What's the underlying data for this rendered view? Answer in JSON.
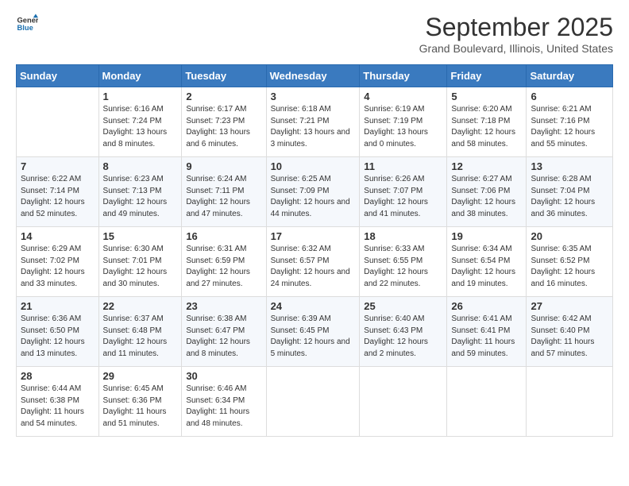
{
  "logo": {
    "line1": "General",
    "line2": "Blue"
  },
  "title": "September 2025",
  "location": "Grand Boulevard, Illinois, United States",
  "days_of_week": [
    "Sunday",
    "Monday",
    "Tuesday",
    "Wednesday",
    "Thursday",
    "Friday",
    "Saturday"
  ],
  "weeks": [
    [
      {
        "day": "",
        "sunrise": "",
        "sunset": "",
        "daylight": ""
      },
      {
        "day": "1",
        "sunrise": "Sunrise: 6:16 AM",
        "sunset": "Sunset: 7:24 PM",
        "daylight": "Daylight: 13 hours and 8 minutes."
      },
      {
        "day": "2",
        "sunrise": "Sunrise: 6:17 AM",
        "sunset": "Sunset: 7:23 PM",
        "daylight": "Daylight: 13 hours and 6 minutes."
      },
      {
        "day": "3",
        "sunrise": "Sunrise: 6:18 AM",
        "sunset": "Sunset: 7:21 PM",
        "daylight": "Daylight: 13 hours and 3 minutes."
      },
      {
        "day": "4",
        "sunrise": "Sunrise: 6:19 AM",
        "sunset": "Sunset: 7:19 PM",
        "daylight": "Daylight: 13 hours and 0 minutes."
      },
      {
        "day": "5",
        "sunrise": "Sunrise: 6:20 AM",
        "sunset": "Sunset: 7:18 PM",
        "daylight": "Daylight: 12 hours and 58 minutes."
      },
      {
        "day": "6",
        "sunrise": "Sunrise: 6:21 AM",
        "sunset": "Sunset: 7:16 PM",
        "daylight": "Daylight: 12 hours and 55 minutes."
      }
    ],
    [
      {
        "day": "7",
        "sunrise": "Sunrise: 6:22 AM",
        "sunset": "Sunset: 7:14 PM",
        "daylight": "Daylight: 12 hours and 52 minutes."
      },
      {
        "day": "8",
        "sunrise": "Sunrise: 6:23 AM",
        "sunset": "Sunset: 7:13 PM",
        "daylight": "Daylight: 12 hours and 49 minutes."
      },
      {
        "day": "9",
        "sunrise": "Sunrise: 6:24 AM",
        "sunset": "Sunset: 7:11 PM",
        "daylight": "Daylight: 12 hours and 47 minutes."
      },
      {
        "day": "10",
        "sunrise": "Sunrise: 6:25 AM",
        "sunset": "Sunset: 7:09 PM",
        "daylight": "Daylight: 12 hours and 44 minutes."
      },
      {
        "day": "11",
        "sunrise": "Sunrise: 6:26 AM",
        "sunset": "Sunset: 7:07 PM",
        "daylight": "Daylight: 12 hours and 41 minutes."
      },
      {
        "day": "12",
        "sunrise": "Sunrise: 6:27 AM",
        "sunset": "Sunset: 7:06 PM",
        "daylight": "Daylight: 12 hours and 38 minutes."
      },
      {
        "day": "13",
        "sunrise": "Sunrise: 6:28 AM",
        "sunset": "Sunset: 7:04 PM",
        "daylight": "Daylight: 12 hours and 36 minutes."
      }
    ],
    [
      {
        "day": "14",
        "sunrise": "Sunrise: 6:29 AM",
        "sunset": "Sunset: 7:02 PM",
        "daylight": "Daylight: 12 hours and 33 minutes."
      },
      {
        "day": "15",
        "sunrise": "Sunrise: 6:30 AM",
        "sunset": "Sunset: 7:01 PM",
        "daylight": "Daylight: 12 hours and 30 minutes."
      },
      {
        "day": "16",
        "sunrise": "Sunrise: 6:31 AM",
        "sunset": "Sunset: 6:59 PM",
        "daylight": "Daylight: 12 hours and 27 minutes."
      },
      {
        "day": "17",
        "sunrise": "Sunrise: 6:32 AM",
        "sunset": "Sunset: 6:57 PM",
        "daylight": "Daylight: 12 hours and 24 minutes."
      },
      {
        "day": "18",
        "sunrise": "Sunrise: 6:33 AM",
        "sunset": "Sunset: 6:55 PM",
        "daylight": "Daylight: 12 hours and 22 minutes."
      },
      {
        "day": "19",
        "sunrise": "Sunrise: 6:34 AM",
        "sunset": "Sunset: 6:54 PM",
        "daylight": "Daylight: 12 hours and 19 minutes."
      },
      {
        "day": "20",
        "sunrise": "Sunrise: 6:35 AM",
        "sunset": "Sunset: 6:52 PM",
        "daylight": "Daylight: 12 hours and 16 minutes."
      }
    ],
    [
      {
        "day": "21",
        "sunrise": "Sunrise: 6:36 AM",
        "sunset": "Sunset: 6:50 PM",
        "daylight": "Daylight: 12 hours and 13 minutes."
      },
      {
        "day": "22",
        "sunrise": "Sunrise: 6:37 AM",
        "sunset": "Sunset: 6:48 PM",
        "daylight": "Daylight: 12 hours and 11 minutes."
      },
      {
        "day": "23",
        "sunrise": "Sunrise: 6:38 AM",
        "sunset": "Sunset: 6:47 PM",
        "daylight": "Daylight: 12 hours and 8 minutes."
      },
      {
        "day": "24",
        "sunrise": "Sunrise: 6:39 AM",
        "sunset": "Sunset: 6:45 PM",
        "daylight": "Daylight: 12 hours and 5 minutes."
      },
      {
        "day": "25",
        "sunrise": "Sunrise: 6:40 AM",
        "sunset": "Sunset: 6:43 PM",
        "daylight": "Daylight: 12 hours and 2 minutes."
      },
      {
        "day": "26",
        "sunrise": "Sunrise: 6:41 AM",
        "sunset": "Sunset: 6:41 PM",
        "daylight": "Daylight: 11 hours and 59 minutes."
      },
      {
        "day": "27",
        "sunrise": "Sunrise: 6:42 AM",
        "sunset": "Sunset: 6:40 PM",
        "daylight": "Daylight: 11 hours and 57 minutes."
      }
    ],
    [
      {
        "day": "28",
        "sunrise": "Sunrise: 6:44 AM",
        "sunset": "Sunset: 6:38 PM",
        "daylight": "Daylight: 11 hours and 54 minutes."
      },
      {
        "day": "29",
        "sunrise": "Sunrise: 6:45 AM",
        "sunset": "Sunset: 6:36 PM",
        "daylight": "Daylight: 11 hours and 51 minutes."
      },
      {
        "day": "30",
        "sunrise": "Sunrise: 6:46 AM",
        "sunset": "Sunset: 6:34 PM",
        "daylight": "Daylight: 11 hours and 48 minutes."
      },
      {
        "day": "",
        "sunrise": "",
        "sunset": "",
        "daylight": ""
      },
      {
        "day": "",
        "sunrise": "",
        "sunset": "",
        "daylight": ""
      },
      {
        "day": "",
        "sunrise": "",
        "sunset": "",
        "daylight": ""
      },
      {
        "day": "",
        "sunrise": "",
        "sunset": "",
        "daylight": ""
      }
    ]
  ]
}
